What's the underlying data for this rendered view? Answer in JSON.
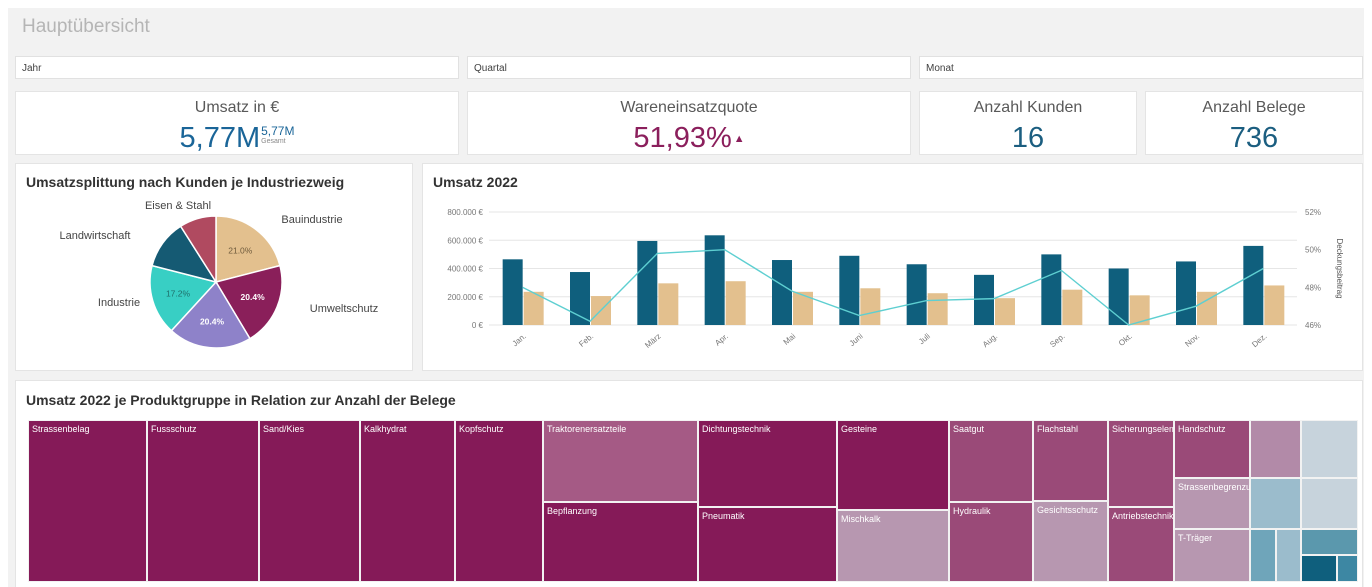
{
  "page": {
    "title": "Hauptübersicht"
  },
  "filters": [
    {
      "label": "Jahr"
    },
    {
      "label": "Quartal"
    },
    {
      "label": "Monat"
    }
  ],
  "kpis": {
    "umsatz": {
      "label": "Umsatz in €",
      "value": "5,77M",
      "sup_value": "5,77M",
      "sup_label": "Gesamt",
      "color": "#1a6598"
    },
    "wareneinsatz": {
      "label": "Wareneinsatzquote",
      "value": "51,93%",
      "indicator": "▲",
      "color": "#8b1f5c"
    },
    "kunden": {
      "label": "Anzahl Kunden",
      "value": "16",
      "color": "#1b5e80"
    },
    "belege": {
      "label": "Anzahl Belege",
      "value": "736",
      "color": "#1b5e80"
    }
  },
  "pie_card": {
    "title": "Umsatzsplittung nach Kunden je Industriezweig"
  },
  "bar_card": {
    "title": "Umsatz 2022",
    "right_axis_title": "Deckungsbeitrag"
  },
  "treemap_card": {
    "title": "Umsatz 2022 je Produktgruppe in Relation zur Anzahl der Belege"
  },
  "chart_data": [
    {
      "type": "pie",
      "title": "Umsatzsplittung nach Kunden je Industriezweig",
      "slices": [
        {
          "name": "Bauindustrie",
          "value": 21.0,
          "label": "21.0%",
          "color": "#e3c08e"
        },
        {
          "name": "Umweltschutz",
          "value": 20.4,
          "label": "20.4%",
          "color": "#8a1f5a"
        },
        {
          "name": "",
          "value": 20.4,
          "label": "20.4%",
          "color": "#8e82c9"
        },
        {
          "name": "Industrie",
          "value": 17.2,
          "label": "17.2%",
          "color": "#38cfc4"
        },
        {
          "name": "Landwirtschaft",
          "value": 12.0,
          "label": "",
          "color": "#155a73"
        },
        {
          "name": "Eisen & Stahl",
          "value": 9.0,
          "label": "",
          "color": "#b04a60"
        }
      ]
    },
    {
      "type": "bar",
      "title": "Umsatz 2022",
      "categories": [
        "Jan.",
        "Feb.",
        "März",
        "Apr.",
        "Mai",
        "Juni",
        "Juli",
        "Aug.",
        "Sep.",
        "Okt.",
        "Nov.",
        "Dez."
      ],
      "series": [
        {
          "values": [
            465000,
            375000,
            595000,
            635000,
            460000,
            490000,
            430000,
            355000,
            500000,
            400000,
            450000,
            560000
          ],
          "color": "#0f5f7d"
        },
        {
          "values": [
            235000,
            205000,
            295000,
            310000,
            235000,
            260000,
            225000,
            190000,
            250000,
            210000,
            235000,
            280000
          ],
          "color": "#e3c08e"
        }
      ],
      "line": {
        "values": [
          48.0,
          46.2,
          49.8,
          50.0,
          47.8,
          46.5,
          47.3,
          47.4,
          48.9,
          46.0,
          47.0,
          49.0
        ],
        "color": "#5ecfd1"
      },
      "yticks_left": [
        "800.000 €",
        "600.000 €",
        "400.000 €",
        "200.000 €",
        "0 €"
      ],
      "yticks_right": [
        "52%",
        "50%",
        "48%",
        "46%"
      ],
      "ylim_left": [
        0,
        800000
      ],
      "ylim_right": [
        46,
        52
      ],
      "y2label": "Deckungsbeitrag"
    },
    {
      "type": "treemap",
      "title": "Umsatz 2022 je Produktgruppe in Relation zur Anzahl der Belege",
      "items": [
        {
          "label": "Strassenbelag",
          "color": "#851a58"
        },
        {
          "label": "Fussschutz",
          "color": "#851a58"
        },
        {
          "label": "Sand/Kies",
          "color": "#851a58"
        },
        {
          "label": "Kalkhydrat",
          "color": "#851a58"
        },
        {
          "label": "Kopfschutz",
          "color": "#851a58"
        },
        {
          "label": "Traktorenersatzteile",
          "color": "#a55a85"
        },
        {
          "label": "Bepflanzung",
          "color": "#851a58"
        },
        {
          "label": "Dichtungstechnik",
          "color": "#851a58"
        },
        {
          "label": "Pneumatik",
          "color": "#851a58"
        },
        {
          "label": "Gesteine",
          "color": "#851a58"
        },
        {
          "label": "Mischkalk",
          "color": "#b797b0"
        },
        {
          "label": "Saatgut",
          "color": "#9a4a78"
        },
        {
          "label": "Hydraulik",
          "color": "#9a4a78"
        },
        {
          "label": "Flachstahl",
          "color": "#9a4a78"
        },
        {
          "label": "Gesichtsschutz",
          "color": "#b797b0"
        },
        {
          "label": "Sicherungselemente",
          "color": "#9a4a78"
        },
        {
          "label": "Antriebstechnik",
          "color": "#9a4a78"
        },
        {
          "label": "Handschutz",
          "color": "#9a4a78"
        },
        {
          "label": "Strassenbegrenzung",
          "color": "#b797b0"
        },
        {
          "label": "T-Träger",
          "color": "#b797b0"
        }
      ]
    }
  ]
}
